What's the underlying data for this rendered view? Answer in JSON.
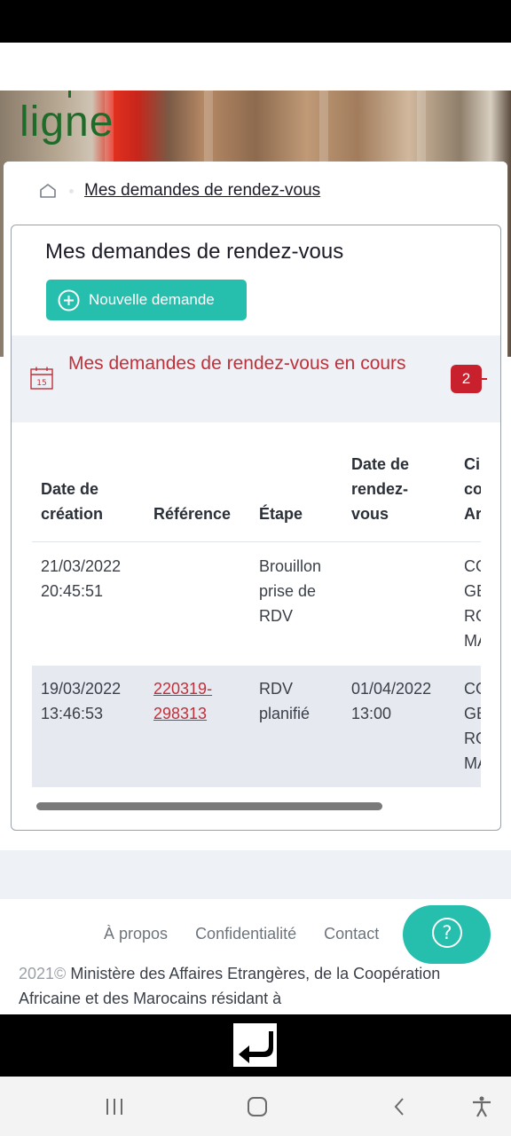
{
  "banner": {
    "text": "ligne"
  },
  "breadcrumb": {
    "current": "Mes demandes de rendez-vous"
  },
  "main": {
    "title": "Mes demandes de rendez-vous",
    "new_button_label": "Nouvelle demande"
  },
  "section": {
    "title": "Mes demandes de rendez-vous en cours",
    "count": "2"
  },
  "table": {
    "headers": {
      "date_creation": [
        "Date de",
        "création"
      ],
      "reference": "Référence",
      "etape": "Étape",
      "date_rdv": [
        "Date de",
        "rendez-",
        "vous"
      ],
      "city": [
        "Ci",
        "co",
        "Ar"
      ]
    },
    "rows": [
      {
        "date_creation": [
          "21/03/2022",
          "20:45:51"
        ],
        "reference": [
          "",
          ""
        ],
        "etape": [
          "Brouillon",
          "prise de",
          "RDV"
        ],
        "date_rdv": [
          "",
          ""
        ],
        "city": [
          "CO",
          "GÉ",
          "RO",
          "MA"
        ]
      },
      {
        "date_creation": [
          "19/03/2022",
          "13:46:53"
        ],
        "reference": [
          "220319-",
          "298313"
        ],
        "etape": [
          "RDV",
          "planifié"
        ],
        "date_rdv": [
          "01/04/2022",
          "13:00"
        ],
        "city": [
          "CO",
          "GÉ",
          "RO",
          "MA"
        ]
      }
    ]
  },
  "footer": {
    "links": [
      "À propos",
      "Confidentialité",
      "Contact"
    ],
    "copyright_year": "2021©",
    "copyright_text": "Ministère des Affaires Etrangères, de la Coopération Africaine et des Marocains résidant à",
    "help_icon": "question-mark-icon"
  },
  "colors": {
    "accent_teal": "#26bfae",
    "alert_red": "#c0303a",
    "badge_red": "#c8202c"
  }
}
